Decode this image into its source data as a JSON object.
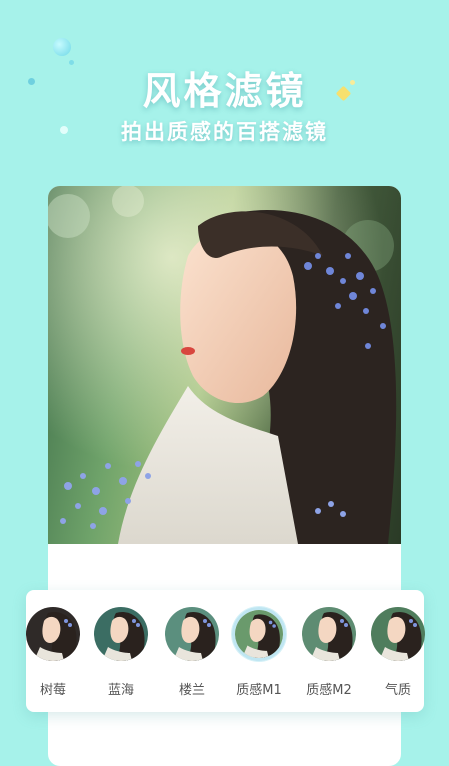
{
  "header": {
    "title": "风格滤镜",
    "subtitle": "拍出质感的百搭滤镜"
  },
  "colors": {
    "background": "#a6f2ea",
    "card": "#ffffff",
    "selected_ring": "#bfe6f2"
  },
  "filters": [
    {
      "label": "树莓",
      "tint": "#2f2a28"
    },
    {
      "label": "蓝海",
      "tint": "#3b6d63"
    },
    {
      "label": "楼兰",
      "tint": "#5b8f7e"
    },
    {
      "label": "质感M1",
      "tint": "#6a9a6c",
      "selected": true
    },
    {
      "label": "质感M2",
      "tint": "#5e8c72"
    },
    {
      "label": "气质",
      "tint": "#4f7d5d"
    }
  ]
}
